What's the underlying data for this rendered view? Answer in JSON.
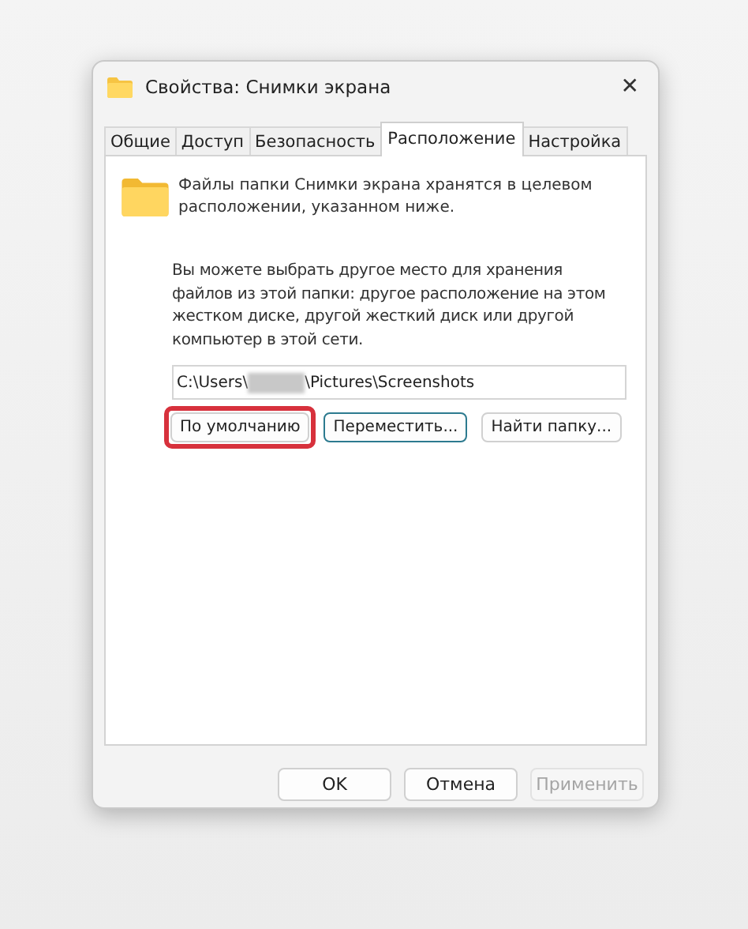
{
  "window": {
    "title": "Свойства: Снимки экрана",
    "close": "✕"
  },
  "tabs": [
    {
      "label": "Общие",
      "selected": false
    },
    {
      "label": "Доступ",
      "selected": false
    },
    {
      "label": "Безопасность",
      "selected": false
    },
    {
      "label": "Расположение",
      "selected": true
    },
    {
      "label": "Настройка",
      "selected": false
    }
  ],
  "info": "Файлы папки Снимки экрана хранятся в целевом расположении, указанном ниже.",
  "description": "Вы можете выбрать другое место для хранения файлов из этой папки: другое расположение на этом жестком диске, другой жесткий диск или другой компьютер в этой сети.",
  "path": {
    "start": "C:\\Users\\",
    "redacted": true,
    "end": "\\Pictures\\Screenshots"
  },
  "location_buttons": [
    {
      "label": "По умолчанию",
      "highlighted": true,
      "focused": false
    },
    {
      "label": "Переместить...",
      "highlighted": false,
      "focused": true
    },
    {
      "label": "Найти папку...",
      "highlighted": false,
      "focused": false
    }
  ],
  "footer_buttons": [
    {
      "label": "OK",
      "disabled": false
    },
    {
      "label": "Отмена",
      "disabled": false
    },
    {
      "label": "Применить",
      "disabled": true
    }
  ]
}
